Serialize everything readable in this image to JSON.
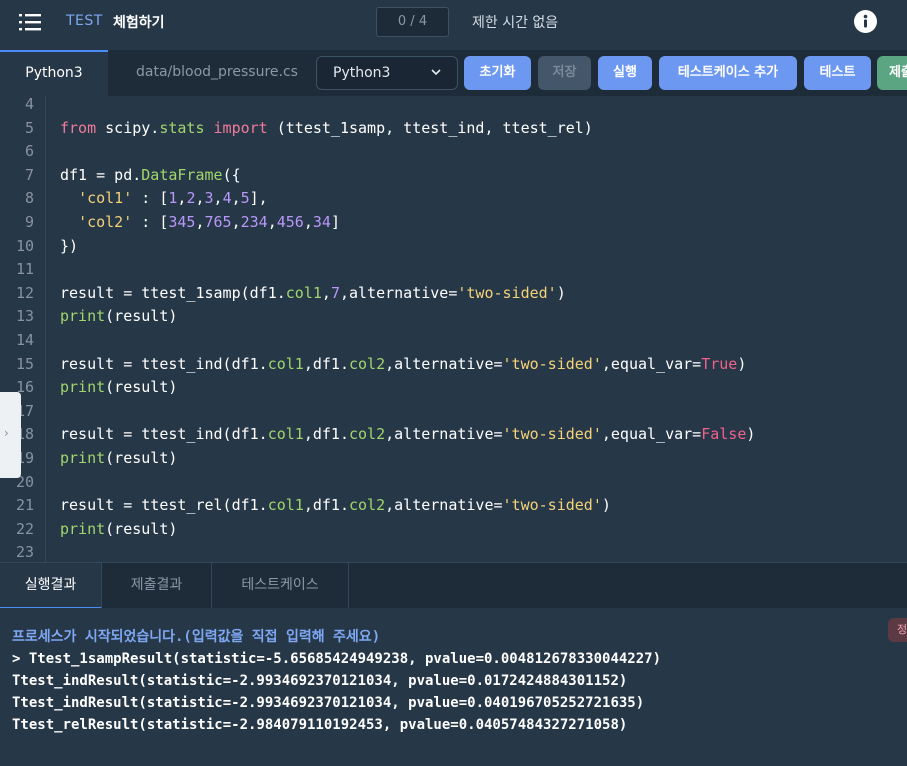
{
  "header": {
    "brand_test": "TEST",
    "brand_title": "체험하기",
    "progress": "0 / 4",
    "time_limit": "제한 시간 없음"
  },
  "tabs": {
    "active_file": "Python3",
    "second_file": "data/blood_pressure.csv",
    "language": "Python3"
  },
  "toolbar": {
    "reset": "초기화",
    "save": "저장",
    "run": "실행",
    "add_testcase": "테스트케이스 추가",
    "test": "테스트",
    "submit": "제출"
  },
  "code": {
    "line_numbers": [
      "4",
      "5",
      "6",
      "7",
      "8",
      "9",
      "10",
      "11",
      "12",
      "13",
      "14",
      "15",
      "16",
      "17",
      "18",
      "19",
      "20",
      "21",
      "22",
      "23"
    ]
  },
  "result_tabs": {
    "run_result": "실행결과",
    "submit_result": "제출결과",
    "testcase": "테스트케이스"
  },
  "output": {
    "process_started": "프로세스가 시작되었습니다.(입력값을 직접 입력해 주세요)",
    "lines": [
      "> Ttest_1sampResult(statistic=-5.65685424949238, pvalue=0.004812678330044227)",
      "Ttest_indResult(statistic=-2.9934692370121034, pvalue=0.0172424884301152)",
      "Ttest_indResult(statistic=-2.9934692370121034, pvalue=0.040196705252721635)",
      "Ttest_relResult(statistic=-2.984079110192453, pvalue=0.04057484327271058)"
    ],
    "copy_label": "정지"
  },
  "colors": {
    "background": "#263747",
    "accent": "#6d98f2",
    "keyword": "#f07a9a",
    "function": "#a0d66c",
    "string": "#f3d278",
    "number": "#b898f8"
  }
}
